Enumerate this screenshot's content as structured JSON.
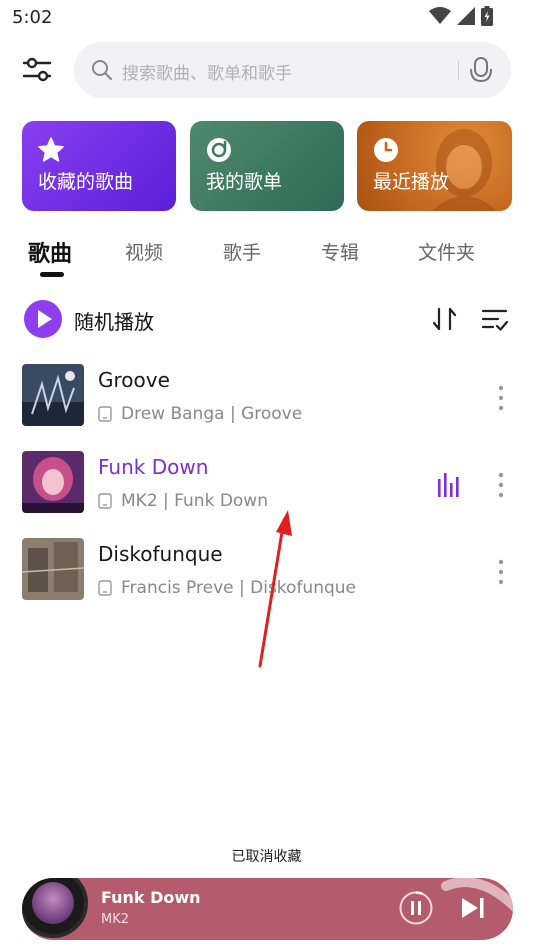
{
  "status": {
    "time": "5:02"
  },
  "search": {
    "placeholder": "搜索歌曲、歌单和歌手"
  },
  "cards": [
    {
      "label": "收藏的歌曲",
      "icon": "star-icon"
    },
    {
      "label": "我的歌单",
      "icon": "playlist-disc-icon"
    },
    {
      "label": "最近播放",
      "icon": "clock-icon"
    }
  ],
  "tabs": [
    "歌曲",
    "视频",
    "歌手",
    "专辑",
    "文件夹"
  ],
  "active_tab": "歌曲",
  "shuffle": {
    "label": "随机播放"
  },
  "songs": [
    {
      "title": "Groove",
      "subtitle": "Drew Banga | Groove",
      "playing": false
    },
    {
      "title": "Funk Down",
      "subtitle": "MK2 | Funk Down",
      "playing": true
    },
    {
      "title": "Diskofunque",
      "subtitle": "Francis Preve | Diskofunque",
      "playing": false
    }
  ],
  "toast": "已取消收藏",
  "mini_player": {
    "title": "Funk Down",
    "artist": "MK2"
  },
  "colors": {
    "accent": "#8e3ef0",
    "playing_text": "#7b2fd8",
    "mini_player_bg": "#b55c6c",
    "arrow": "#e02020"
  }
}
